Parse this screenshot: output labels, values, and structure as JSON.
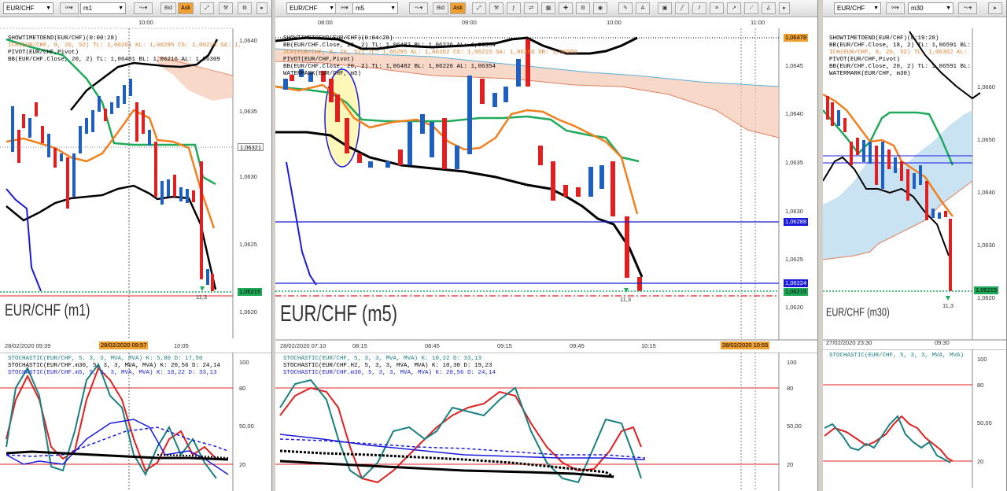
{
  "colors": {
    "ask": "#f0a030",
    "bull": "#1f5fbf",
    "bear": "#e02020",
    "green": "#1faa5a",
    "orange": "#f08020",
    "blue": "#1a1adb",
    "teal": "#1a8080",
    "cloud": "#f5c8b0"
  },
  "panels": [
    {
      "symbol": "EUR/CHF",
      "timeframe": "m1",
      "bid": "Bid",
      "ask": "Ask",
      "top_time": "10:00",
      "indicators": [
        {
          "text": "SHOWTIMETOEND(EUR/CHF)(0:00:28)",
          "color": "#000"
        },
        {
          "text": "ICH(EUR/CHF, 9, 26, 52)   TL: 1,06261  KL: 1,06295  CS: 1,06215  SA: 1,",
          "color": "#e08030"
        },
        {
          "text": "PIVOT(EUR/CHF,Pivot)",
          "color": "#000"
        },
        {
          "text": "BB(EUR/CHF.Close, 20, 2)  TL: 1,06401  BL: 1,06216  AL: 1,06309",
          "color": "#000"
        }
      ],
      "watermark": "EUR/CHF (m1)",
      "price_labels": [
        "1,0640",
        "1,0635",
        "1,0630",
        "1,0625",
        "1,0620"
      ],
      "tags": [
        "1,06321",
        "1,06215"
      ],
      "bar_counter": "11,3",
      "time_labels": [
        "28/02/2020 09:39",
        "28/02/2020 09:57",
        "10:05"
      ],
      "stoch": [
        {
          "text": "STOCHASTIC(EUR/CHF, 5, 3, 3, MVA, MVA)   K: 5,80  D: 17,50",
          "color": "#1a8080"
        },
        {
          "text": "STOCHASTIC(EUR/CHF.m30, 5, 3, 3, MVA, MVA)  K: 20,56  D: 24,14",
          "color": "#000"
        },
        {
          "text": "STOCHASTIC(EUR/CHF.m5, 5, 3, 3, MVA, MVA)  K: 10,22  D: 33,13",
          "color": "#1a1adb"
        }
      ],
      "stoch_levels": [
        "100",
        "80",
        "50,00",
        "20"
      ]
    },
    {
      "symbol": "EUR/CHF",
      "timeframe": "m5",
      "bid": "Bid",
      "ask": "Ask",
      "top_times": [
        "08:00",
        "09:00",
        "10:00",
        "11:00"
      ],
      "indicators": [
        {
          "text": "SHOWTIMETOEND(EUR/CHF)(0:04:28)",
          "color": "#000"
        },
        {
          "text": "BB(EUR/CHF.Close, 20, 2)  TL: 1,06482  BL: 1,06226  AL: 1,06354",
          "color": "#000"
        },
        {
          "text": "ICH(EUR/CHF, 9, 26, 52)   TL: 1,06295  KL: 1,06352  CS: 1,06215  SA: 1,06386  SB: 1,06500",
          "color": "#e08030"
        },
        {
          "text": "PIVOT(EUR/CHF,Pivot)",
          "color": "#000"
        },
        {
          "text": "BB(EUR/CHF.Close, 20, 2)  TL: 1,06482  BL: 1,06226  AL: 1,06354",
          "color": "#000"
        },
        {
          "text": "WATERMARK(EUR/CHF, m5)",
          "color": "#000"
        }
      ],
      "watermark": "EUR/CHF (m5)",
      "price_labels": [
        "1,0645",
        "1,0640",
        "1,0635",
        "1,0630",
        "1,0625",
        "1,0620"
      ],
      "tags": [
        "1,06478",
        "1,06288",
        "1,06224",
        "1,06215"
      ],
      "bar_counter": "11,3",
      "time_labels": [
        "28/02/2020 07:10",
        "08:15",
        "08:45",
        "09:15",
        "09:45",
        "10:15",
        "28/02/2020 10:55"
      ],
      "stoch": [
        {
          "text": "STOCHASTIC(EUR/CHF, 5, 3, 3, MVA, MVA)   K: 10,22  D: 33,13",
          "color": "#1a8080"
        },
        {
          "text": "STOCHASTIC(EUR/CHF.H2, 5, 3, 3, MVA, MVA)  K: 10,30  D: 19,23",
          "color": "#000"
        },
        {
          "text": "STOCHASTIC(EUR/CHF.m30, 5, 3, 3, MVA, MVA)  K: 20,56  D: 24,14",
          "color": "#1a1adb"
        }
      ],
      "stoch_levels": [
        "100",
        "80",
        "50,00",
        "20"
      ]
    },
    {
      "symbol": "EUR/CHF",
      "timeframe": "m30",
      "bid": "Bid",
      "ask": "Ask",
      "indicators": [
        {
          "text": "SHOWTIMETOEND(EUR/CHF)(0:19:28)",
          "color": "#000"
        },
        {
          "text": "BB(EUR/CHF.Close, 18, 2)  TL: 1,06591  BL:",
          "color": "#000"
        },
        {
          "text": "ICH(EUR/CHF, 9, 26, 52)  TL: 1,06352  KL:",
          "color": "#e08030"
        },
        {
          "text": "PIVOT(EUR/CHF,Pivot)",
          "color": "#000"
        },
        {
          "text": "BB(EUR/CHF.Close, 20, 2)  TL: 1,06591  BL:",
          "color": "#000"
        },
        {
          "text": "WATERMARK(EUR/CHF, m30)",
          "color": "#000"
        }
      ],
      "watermark": "EUR/CHF (m30)",
      "price_labels": [
        "1,0660",
        "1,0650",
        "1,0640",
        "1,0630",
        "1,0620"
      ],
      "tags": [
        "1,06215"
      ],
      "bar_counter": "11,3",
      "time_labels": [
        "27/02/2020 23:30",
        "09:30"
      ],
      "stoch": [
        {
          "text": "STOCHASTIC(EUR/CHF, 5, 3, 3, MVA, MVA)",
          "color": "#1a8080"
        }
      ],
      "stoch_levels": [
        "100",
        "80",
        "50,00",
        "20"
      ]
    }
  ]
}
